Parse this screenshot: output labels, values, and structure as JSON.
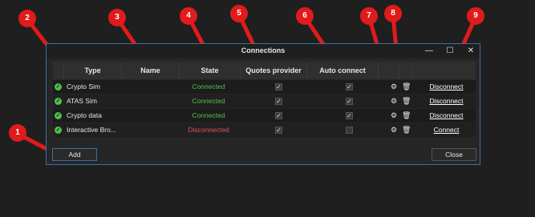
{
  "window": {
    "title": "Connections",
    "buttons": {
      "minimize": "—",
      "maximize": "☐",
      "close": "✕"
    }
  },
  "table": {
    "headers": [
      "",
      "Type",
      "Name",
      "State",
      "Quotes provider",
      "Auto connect",
      "",
      "",
      ""
    ],
    "rows": [
      {
        "type": "Crypto Sim",
        "state": "Connected",
        "quotes_provider": true,
        "auto_connect": true,
        "action": "Disconnect"
      },
      {
        "type": "ATAS Sim",
        "state": "Connected",
        "quotes_provider": true,
        "auto_connect": true,
        "action": "Disconnect"
      },
      {
        "type": "Crypto data",
        "state": "Connected",
        "quotes_provider": true,
        "auto_connect": true,
        "action": "Disconnect"
      },
      {
        "type": "Interactive Bro...",
        "state": "Disconnected",
        "quotes_provider": true,
        "auto_connect": false,
        "action": "Connect"
      }
    ]
  },
  "footer": {
    "add_label": "Add",
    "close_label": "Close"
  },
  "callouts": [
    "1",
    "2",
    "3",
    "4",
    "5",
    "6",
    "7",
    "8",
    "9"
  ],
  "colors": {
    "connected": "#4cc24c",
    "disconnected": "#e05555",
    "callout": "#e01b1b",
    "window_border": "#3a6ea5"
  },
  "icons": {
    "status": "check-circle-icon",
    "settings": "gear-icon",
    "delete": "trash-icon"
  }
}
